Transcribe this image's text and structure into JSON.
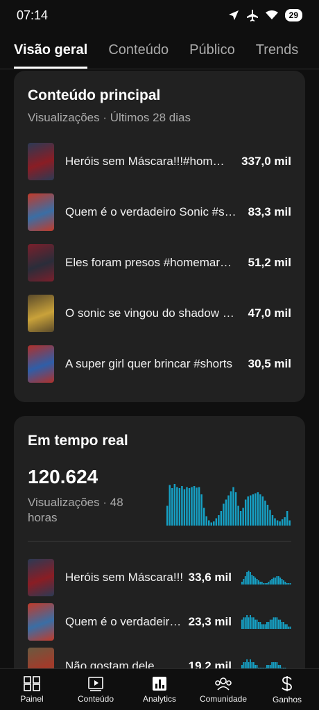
{
  "status_bar": {
    "time": "07:14",
    "battery": "29"
  },
  "tabs": [
    {
      "label": "Visão geral",
      "active": true
    },
    {
      "label": "Conteúdo",
      "active": false
    },
    {
      "label": "Público",
      "active": false
    },
    {
      "label": "Trends",
      "active": false
    }
  ],
  "top_content": {
    "title": "Conteúdo principal",
    "subtitle": "Visualizações · Últimos 28 dias",
    "items": [
      {
        "title": "Heróis sem Máscara!!!#homemaranha #shorts",
        "value": "337,0 mil",
        "thumb_colors": [
          "#8a1d24",
          "#2b3a55"
        ]
      },
      {
        "title": "Quem é o verdadeiro Sonic #shorts",
        "value": "83,3 mil",
        "thumb_colors": [
          "#3a6ea5",
          "#c23b2a"
        ]
      },
      {
        "title": "Eles foram presos #homemaranha",
        "value": "51,2 mil",
        "thumb_colors": [
          "#2a2d3a",
          "#7a1f2b"
        ]
      },
      {
        "title": "O sonic se vingou do shadow #shorts",
        "value": "47,0 mil",
        "thumb_colors": [
          "#c9a23a",
          "#5a4a2a"
        ]
      },
      {
        "title": "A super girl quer brincar #shorts",
        "value": "30,5 mil",
        "thumb_colors": [
          "#2f5ea8",
          "#b0302a"
        ]
      }
    ]
  },
  "realtime": {
    "title": "Em tempo real",
    "total": "120.624",
    "label": "Visualizações · 48 horas",
    "accent": "#16a0c4",
    "chart_data": {
      "type": "bar",
      "values": [
        38,
        78,
        72,
        80,
        74,
        72,
        76,
        70,
        74,
        72,
        74,
        76,
        73,
        74,
        60,
        34,
        18,
        10,
        6,
        8,
        14,
        20,
        28,
        42,
        50,
        58,
        66,
        74,
        64,
        38,
        28,
        34,
        50,
        56,
        58,
        60,
        62,
        64,
        60,
        56,
        48,
        40,
        30,
        20,
        14,
        10,
        8,
        12,
        16,
        28,
        10
      ]
    },
    "items": [
      {
        "title": "Heróis sem Máscara!!!",
        "value": "33,6 mil",
        "thumb_colors": [
          "#8a1d24",
          "#2b3a55"
        ],
        "spark": [
          2,
          4,
          6,
          9,
          10,
          9,
          7,
          6,
          5,
          4,
          3,
          2,
          2,
          1,
          1,
          1,
          2,
          3,
          4,
          5,
          5,
          6,
          6,
          5,
          4,
          3,
          2,
          1,
          1,
          1
        ]
      },
      {
        "title": "Quem é o verdadeiro Sonic",
        "value": "23,3 mil",
        "thumb_colors": [
          "#3a6ea5",
          "#c23b2a"
        ],
        "spark": [
          4,
          5,
          5,
          6,
          5,
          6,
          5,
          5,
          4,
          4,
          3,
          3,
          2,
          2,
          2,
          3,
          3,
          4,
          4,
          5,
          5,
          5,
          4,
          4,
          3,
          3,
          2,
          2,
          1,
          1
        ]
      },
      {
        "title": "Não gostam dele",
        "value": "19,2 mil",
        "thumb_colors": [
          "#a33a2a",
          "#6a5a40"
        ],
        "spark": [
          3,
          4,
          4,
          5,
          4,
          5,
          4,
          4,
          3,
          3,
          2,
          2,
          2,
          2,
          2,
          3,
          3,
          3,
          4,
          4,
          4,
          4,
          3,
          3,
          2,
          2,
          2,
          1,
          1,
          1
        ]
      }
    ]
  },
  "bottom_nav": [
    {
      "label": "Painel",
      "icon": "dashboard-icon"
    },
    {
      "label": "Conteúdo",
      "icon": "video-library-icon"
    },
    {
      "label": "Analytics",
      "icon": "analytics-icon"
    },
    {
      "label": "Comunidade",
      "icon": "community-icon"
    },
    {
      "label": "Ganhos",
      "icon": "earnings-icon"
    }
  ]
}
